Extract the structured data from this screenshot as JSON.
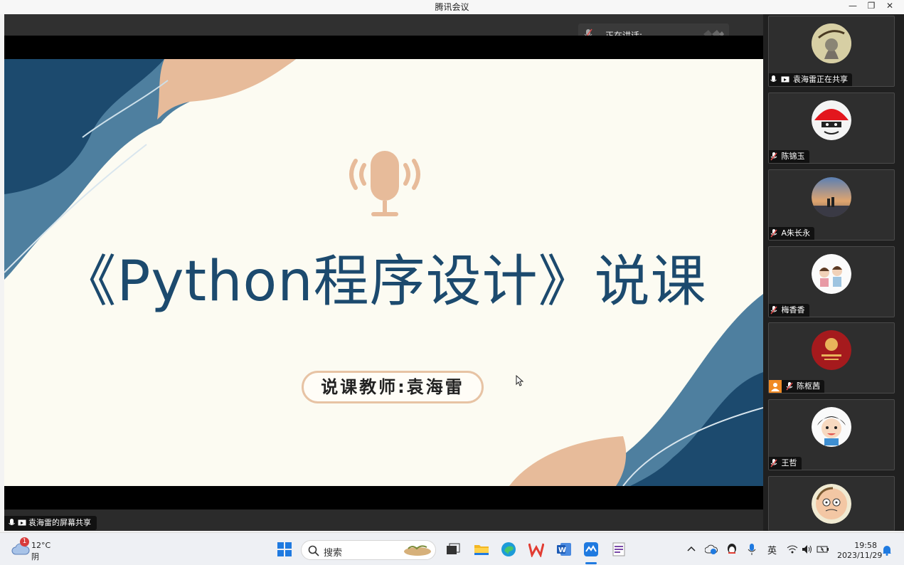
{
  "window": {
    "title": "腾讯会议"
  },
  "stage": {
    "speaking_label": "正在讲话:",
    "share_label": "袁海雷的屏幕共享"
  },
  "slide": {
    "title": "《Python程序设计》说课",
    "teacher": "说课教师:袁海雷"
  },
  "slide_toolbar": [
    "prev-icon",
    "play-icon",
    "pen-icon",
    "screenshot-icon",
    "camera-icon",
    "comment-icon",
    "more-icon",
    "collapse-icon"
  ],
  "participants": [
    {
      "name": "袁海雷正在共享"
    },
    {
      "name": "陈锦玉"
    },
    {
      "name": "A朱长永"
    },
    {
      "name": "梅香香"
    },
    {
      "name": "陈枢茜"
    },
    {
      "name": "王哲"
    },
    {
      "name": ""
    }
  ],
  "taskbar": {
    "weather_temp": "12°C",
    "weather_cond": "阴",
    "weather_badge": "1",
    "search_placeholder": "搜索",
    "ime": "英",
    "time": "19:58",
    "date": "2023/11/29"
  },
  "colors": {
    "slide_text": "#1c4a6e",
    "accent_tan": "#e7bb9a",
    "wave_blue": "#4e7f9f"
  }
}
